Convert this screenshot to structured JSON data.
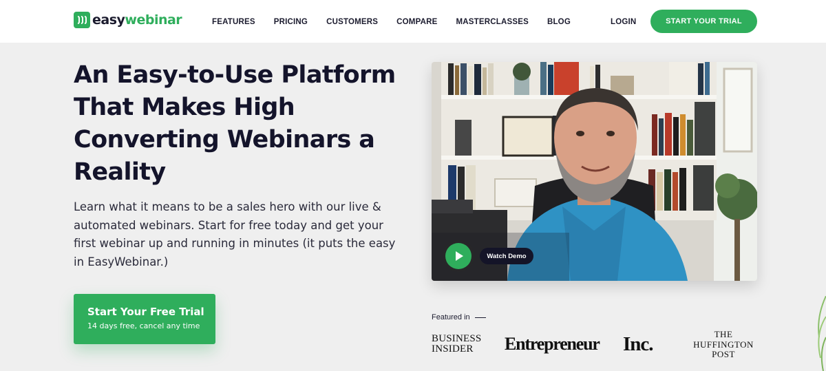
{
  "brand": {
    "name_part1": "easy",
    "name_part2": "webinar",
    "accent": "#2fae5c",
    "dark": "#14142b"
  },
  "nav": {
    "items": [
      "FEATURES",
      "PRICING",
      "CUSTOMERS",
      "COMPARE",
      "MASTERCLASSES",
      "BLOG"
    ],
    "login": "LOGIN",
    "cta": "START YOUR TRIAL"
  },
  "hero": {
    "title": "An Easy-to-Use Platform That Makes High Converting Webinars a Reality",
    "subtitle": "Learn what it means to be a sales hero with our live & automated webinars. Start for free today and get your first webinar up and running in minutes (it puts the easy in EasyWebinar.)",
    "cta_title": "Start Your Free Trial",
    "cta_sub": "14 days free, cancel any time"
  },
  "video": {
    "watch_label": "Watch Demo",
    "play_icon": "play-icon"
  },
  "featured": {
    "label": "Featured in",
    "business_insider": [
      "BUSINESS",
      "INSIDER"
    ],
    "entrepreneur": "Entrepreneur",
    "inc": "Inc.",
    "huffington_post": [
      "THE",
      "HUFFINGTON",
      "POST"
    ]
  }
}
